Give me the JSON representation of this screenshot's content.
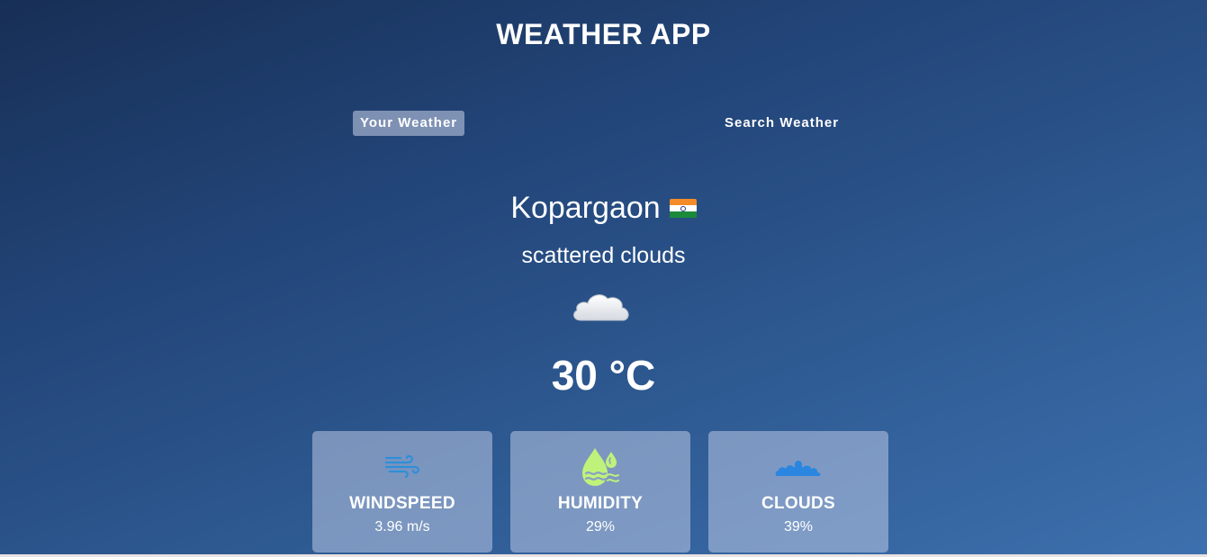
{
  "app": {
    "title": "WEATHER APP"
  },
  "tabs": [
    {
      "label": "Your Weather",
      "active": true
    },
    {
      "label": "Search Weather",
      "active": false
    }
  ],
  "weather": {
    "city": "Kopargaon",
    "country_flag": "india-flag-icon",
    "description": "scattered clouds",
    "icon": "cloud-icon",
    "temperature": "30 °C"
  },
  "stats": [
    {
      "label": "WINDSPEED",
      "value": "3.96 m/s",
      "icon": "wind-icon"
    },
    {
      "label": "HUMIDITY",
      "value": "29%",
      "icon": "humidity-icon"
    },
    {
      "label": "CLOUDS",
      "value": "39%",
      "icon": "clouds-icon"
    }
  ],
  "colors": {
    "active_tab_bg": "#8c9bb9",
    "card_bg": "#8aa0c4",
    "wind_icon": "#2f8fd9",
    "humidity_icon": "#bff27a",
    "clouds_icon": "#2a86e0"
  }
}
